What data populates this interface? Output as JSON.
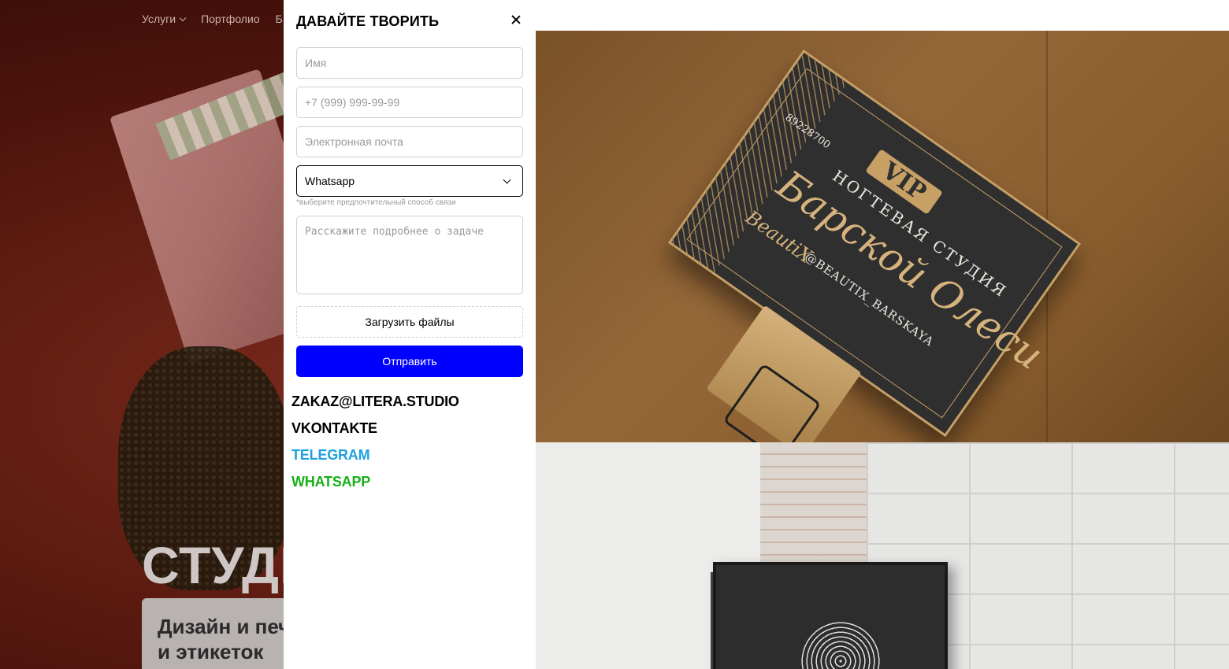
{
  "background_page": {
    "nav": {
      "services_label": "Услуги",
      "portfolio_label": "Портфолио",
      "truncated_label": "Б"
    },
    "hero_title": "СТУДІ",
    "card_title": "Дизайн и печ\nи этикеток"
  },
  "modal": {
    "title": "ДАВАЙТЕ ТВОРИТЬ",
    "name_placeholder": "Имя",
    "phone_placeholder": "+7 (999) 999-99-99",
    "email_placeholder": "Электронная почта",
    "contact_method_selected": "Whatsapp",
    "contact_method_hint": "*выберите предпочтительный способ связи",
    "task_placeholder": "Расскажите подробнее о задаче",
    "upload_label": "Загрузить файлы",
    "submit_label": "Отправить"
  },
  "contacts": {
    "email": "ZAKAZ@LITERA.STUDIO",
    "vk": "VKONTAKTE",
    "telegram": "TELEGRAM",
    "whatsapp": "WHATSAPP"
  },
  "portfolio_images": {
    "business_card": {
      "badge": "VIP",
      "studio": "НОГТЕВАЯ СТУДИЯ",
      "name": "Барской Олеси",
      "phone": "89228700",
      "instagram": "@BEAUTIX_BARSKAYA",
      "brand": "BeautiX"
    }
  },
  "colors": {
    "submit_bg": "#0000ff",
    "telegram": "#1da1e0",
    "whatsapp": "#18b018"
  },
  "icons": {
    "close": "close-icon",
    "select_chevron": "chevron-down-icon",
    "nav_chevron": "chevron-down-icon"
  }
}
